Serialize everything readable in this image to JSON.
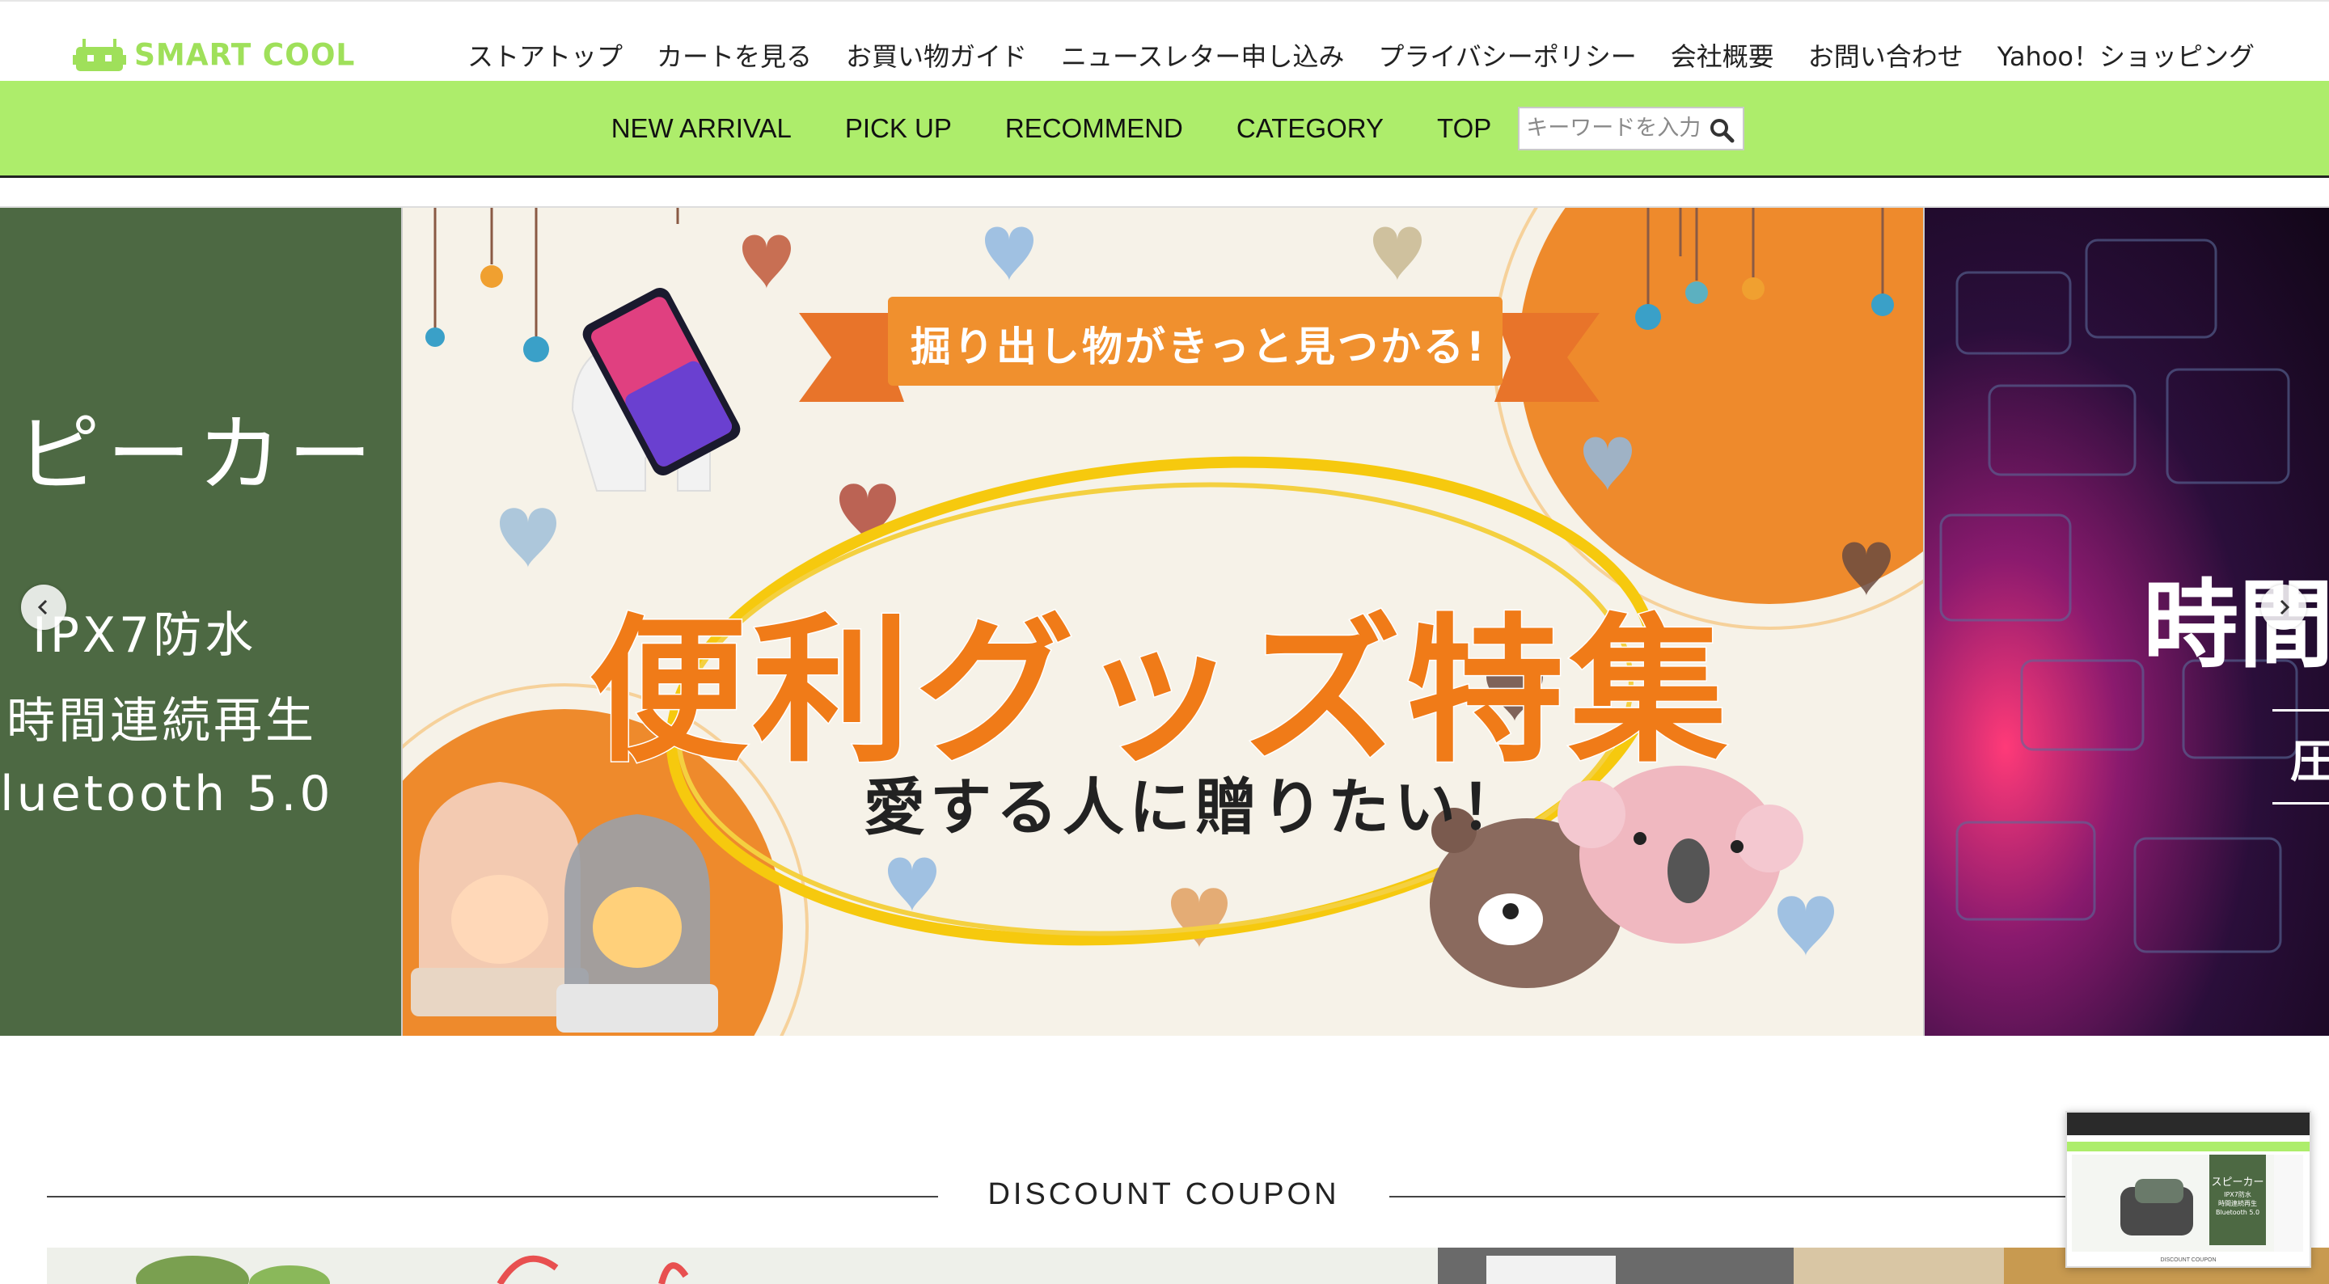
{
  "header": {
    "logo_text": "SMART COOL",
    "top_links": [
      "ストアトップ",
      "カートを見る",
      "お買い物ガイド",
      "ニュースレター申し込み",
      "プライバシーポリシー",
      "会社概要",
      "お問い合わせ",
      "Yahoo！ショッピング"
    ]
  },
  "green_nav": {
    "items": [
      "NEW ARRIVAL",
      "PICK UP",
      "RECOMMEND",
      "CATEGORY",
      "TOP"
    ],
    "search_placeholder": "キーワードを入力"
  },
  "slider": {
    "left_slide": {
      "title": "ピーカー",
      "lines": [
        "IPX7防水",
        "時間連続再生",
        "luetooth 5.0"
      ]
    },
    "main_slide": {
      "ribbon": "掘り出し物がきっと見つかる!",
      "title": "便利グッズ特集",
      "subtitle": "愛する人に贈りたい！"
    },
    "right_slide": {
      "title": "時間",
      "subtitle": "圧"
    }
  },
  "coupon": {
    "title": "DISCOUNT COUPON"
  },
  "preview": {
    "label": "スピーカー",
    "lines": [
      "IPX7防水",
      "時間連続再生",
      "Bluetooth 5.0"
    ],
    "footer": "DISCOUNT COUPON"
  },
  "colors": {
    "nav_green": "#aded6b",
    "logo_green": "#9fe05a",
    "slide_dark_green": "#4d6943",
    "accent_orange": "#f07b18"
  }
}
